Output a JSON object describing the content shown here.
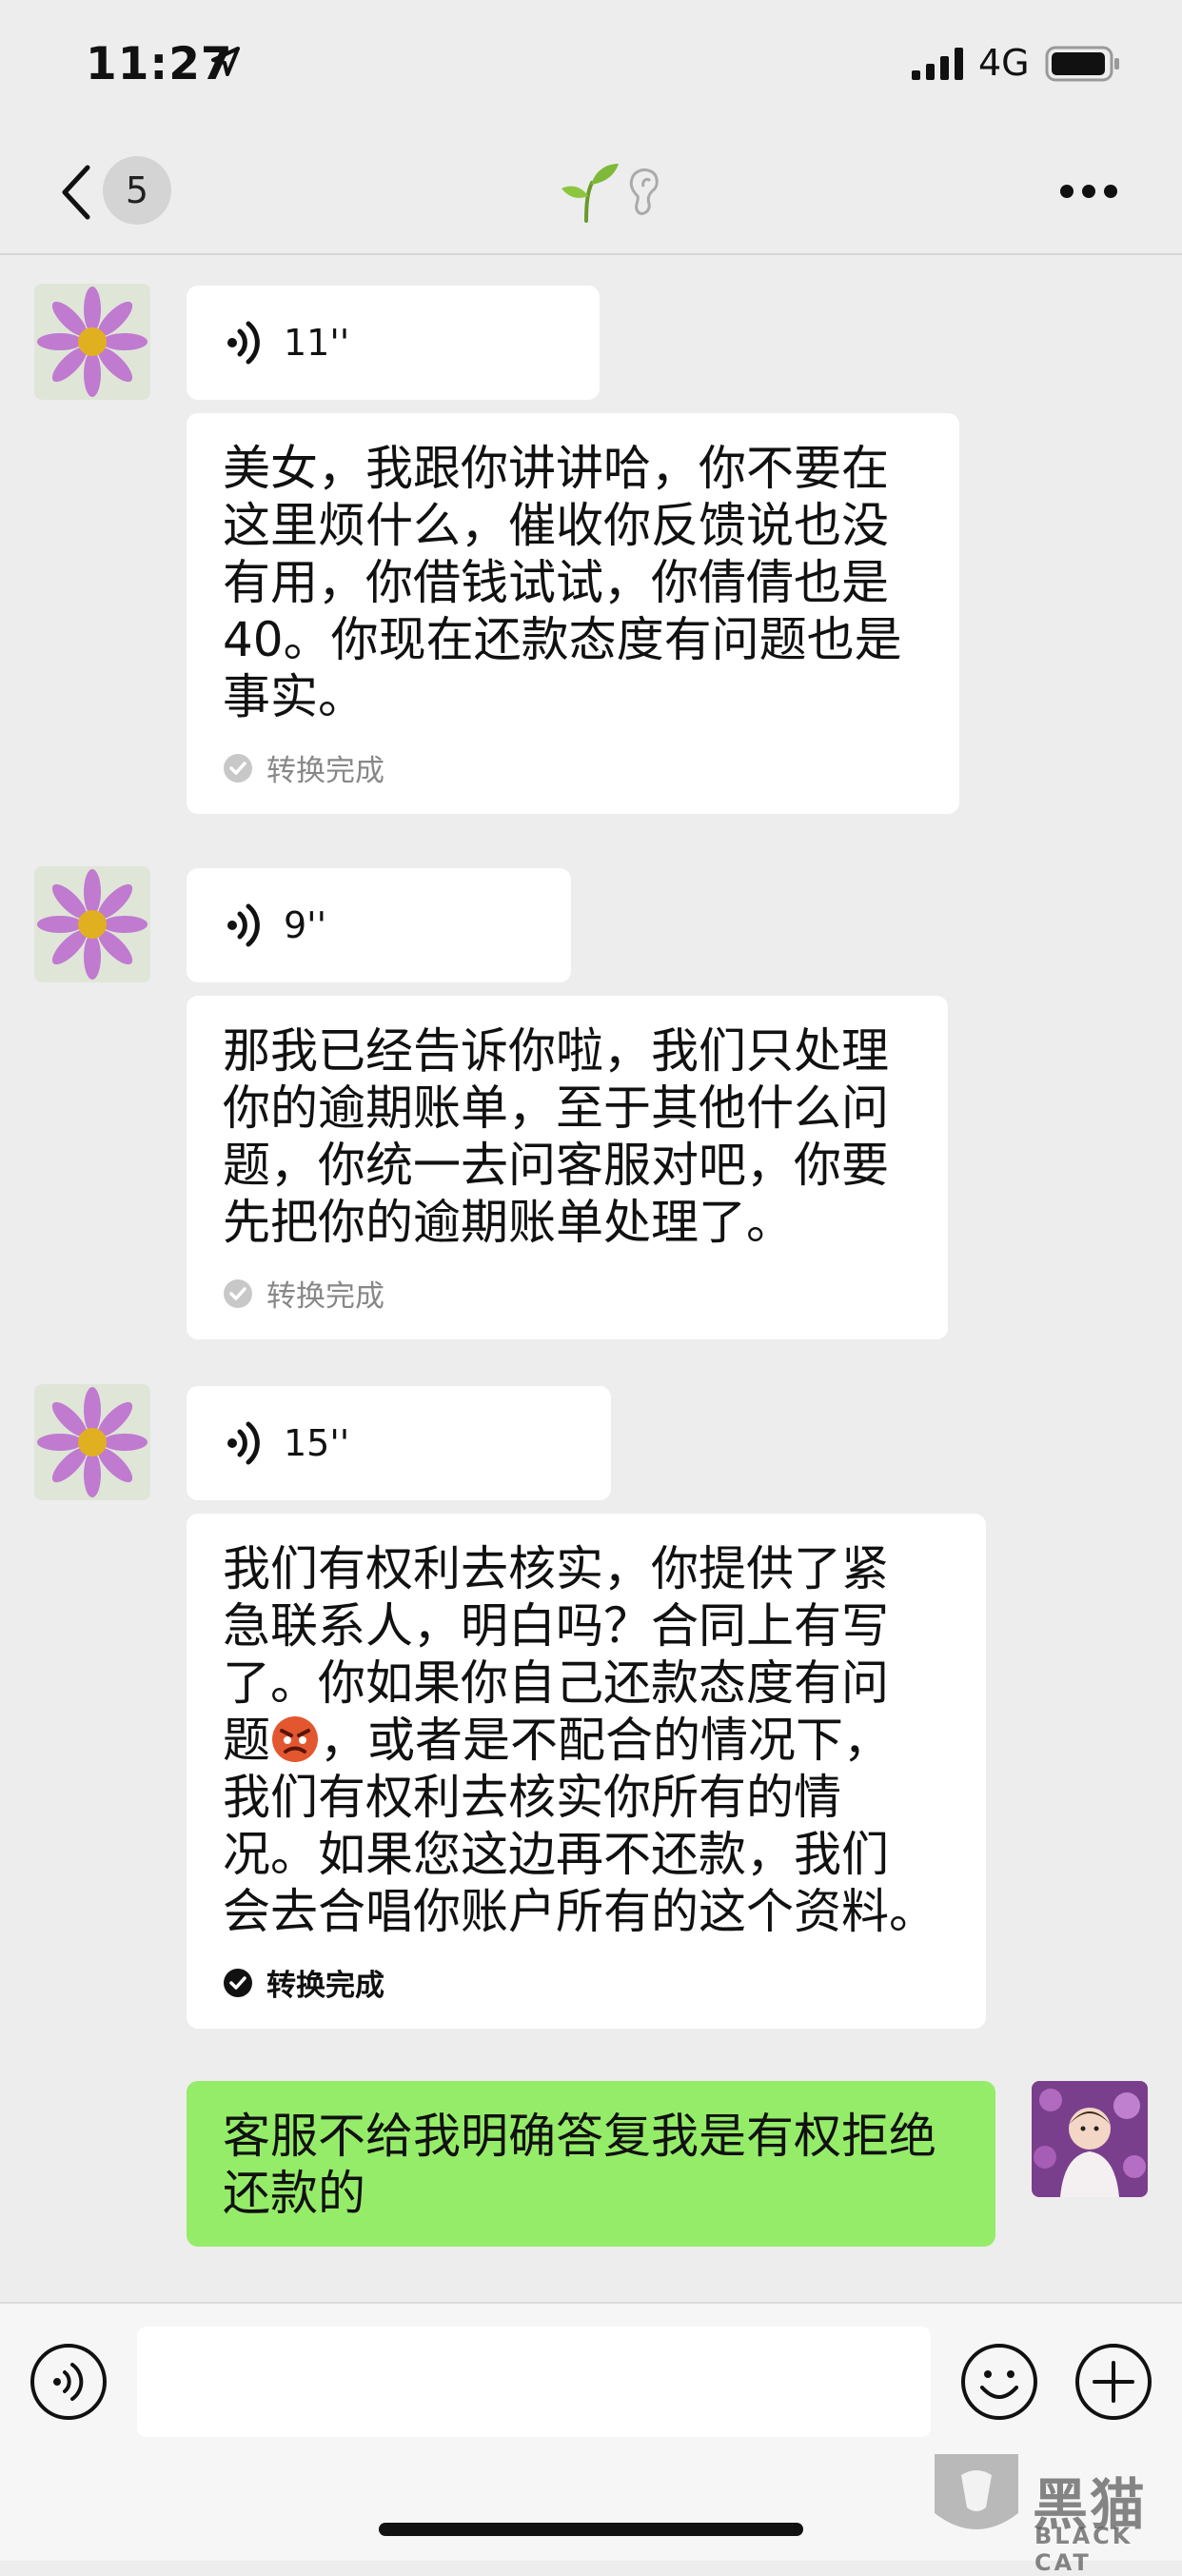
{
  "status_bar": {
    "time": "11:27",
    "network": "4G"
  },
  "nav": {
    "unread_count": "5"
  },
  "messages": [
    {
      "type": "voice",
      "duration": "11''"
    },
    {
      "type": "transcript",
      "lines": [
        "美女，我跟你讲讲哈，你不要在",
        "这里烦什么，催收你反馈说也没",
        "有用，你借钱试试，你倩倩也是",
        "40。你现在还款态度有问题也是",
        "事实。"
      ],
      "status": "转换完成"
    },
    {
      "type": "voice",
      "duration": "9''"
    },
    {
      "type": "transcript",
      "lines": [
        "那我已经告诉你啦，我们只处理",
        "你的逾期账单，至于其他什么问",
        "题，你统一去问客服对吧，你要",
        "先把你的逾期账单处理了。"
      ],
      "status": "转换完成"
    },
    {
      "type": "voice",
      "duration": "15''"
    },
    {
      "type": "transcript",
      "lines": [
        "我们有权利去核实，你提供了紧",
        "急联系人，明白吗？合同上有写",
        "了。你如果你自己还款态度有问",
        "题",
        "，或者是不配合的情况下，",
        "我们有权利去核实你所有的情",
        "况。如果您这边再不还款，我们",
        "会去合唱你账户所有的这个资料。"
      ],
      "status": "转换完成"
    },
    {
      "type": "outgoing",
      "lines": [
        "客服不给我明确答复我是有权拒绝",
        "还款的"
      ]
    }
  ],
  "watermark": {
    "cn": "黑猫",
    "en": "BLACK CAT"
  },
  "colors": {
    "background": "#ededed",
    "outgoing_bubble": "#95ec69",
    "incoming_bubble": "#ffffff"
  },
  "icons": [
    "location-arrow-icon",
    "signal-icon",
    "battery-icon",
    "back-chevron-icon",
    "sprout-icon",
    "ear-icon",
    "more-icon",
    "voice-wave-icon",
    "check-circle-icon",
    "angry-face-emoji",
    "voice-input-icon",
    "smile-icon",
    "plus-icon"
  ]
}
